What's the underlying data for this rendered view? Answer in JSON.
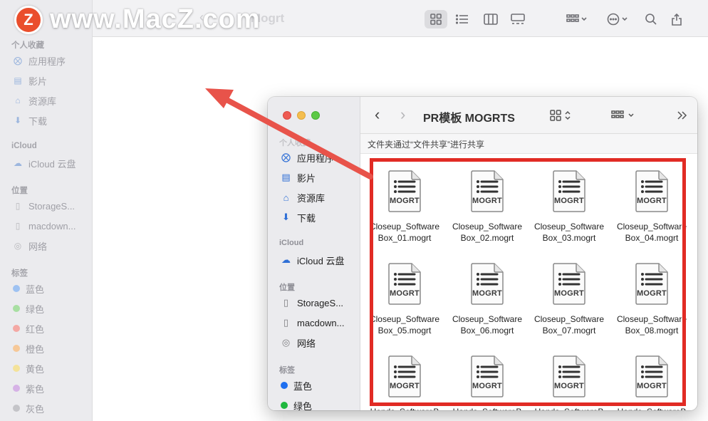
{
  "watermark": {
    "logo_letter": "Z",
    "text": "www.MacZ.com"
  },
  "background_window": {
    "title_partial": "Mogrt",
    "sidebar": {
      "favorites_header": "个人收藏",
      "favorites": [
        "应用程序",
        "影片",
        "资源库",
        "下载"
      ],
      "icloud_header": "iCloud",
      "icloud": [
        "iCloud 云盘"
      ],
      "locations_header": "位置",
      "locations": [
        "StorageS...",
        "macdown...",
        "网络"
      ],
      "tags_header": "标签",
      "tags": [
        {
          "label": "蓝色",
          "color": "#9ec2f2"
        },
        {
          "label": "绿色",
          "color": "#a8dfa2"
        },
        {
          "label": "红色",
          "color": "#f4a8a4"
        },
        {
          "label": "橙色",
          "color": "#f6c898"
        },
        {
          "label": "黄色",
          "color": "#f4e29a"
        },
        {
          "label": "紫色",
          "color": "#d6b2e6"
        },
        {
          "label": "灰色",
          "color": "#c4c4c8"
        }
      ]
    }
  },
  "foreground_window": {
    "title": "PR模板 MOGRTS",
    "share_notice": "文件夹通过“文件共享”进行共享",
    "sidebar": {
      "favorites_header": "个人收藏",
      "favorites": [
        "应用程序",
        "影片",
        "资源库",
        "下载"
      ],
      "icloud_header": "iCloud",
      "icloud": [
        "iCloud 云盘"
      ],
      "locations_header": "位置",
      "locations": [
        "StorageS...",
        "macdown...",
        "网络"
      ],
      "tags_header": "标签",
      "tags": [
        {
          "label": "蓝色",
          "color": "#1e6ff0"
        },
        {
          "label": "绿色",
          "color": "#1fb73e"
        }
      ]
    },
    "file_icon_label": "MOGRT",
    "files": [
      {
        "line1": "Closeup_Software",
        "line2": "Box_01.mogrt"
      },
      {
        "line1": "Closeup_Software",
        "line2": "Box_02.mogrt"
      },
      {
        "line1": "Closeup_Software",
        "line2": "Box_03.mogrt"
      },
      {
        "line1": "Closeup_Software",
        "line2": "Box_04.mogrt"
      },
      {
        "line1": "Closeup_Software",
        "line2": "Box_05.mogrt"
      },
      {
        "line1": "Closeup_Software",
        "line2": "Box_06.mogrt"
      },
      {
        "line1": "Closeup_Software",
        "line2": "Box_07.mogrt"
      },
      {
        "line1": "Closeup_Software",
        "line2": "Box_08.mogrt"
      },
      {
        "line1": "Hands_SoftwareB",
        "line2": ""
      },
      {
        "line1": "Hands_SoftwareB",
        "line2": ""
      },
      {
        "line1": "Hands_SoftwareB",
        "line2": ""
      },
      {
        "line1": "Hands_SoftwareB",
        "line2": ""
      }
    ]
  },
  "colors": {
    "highlight_box": "#e12b24",
    "arrow": "#e8534a"
  }
}
